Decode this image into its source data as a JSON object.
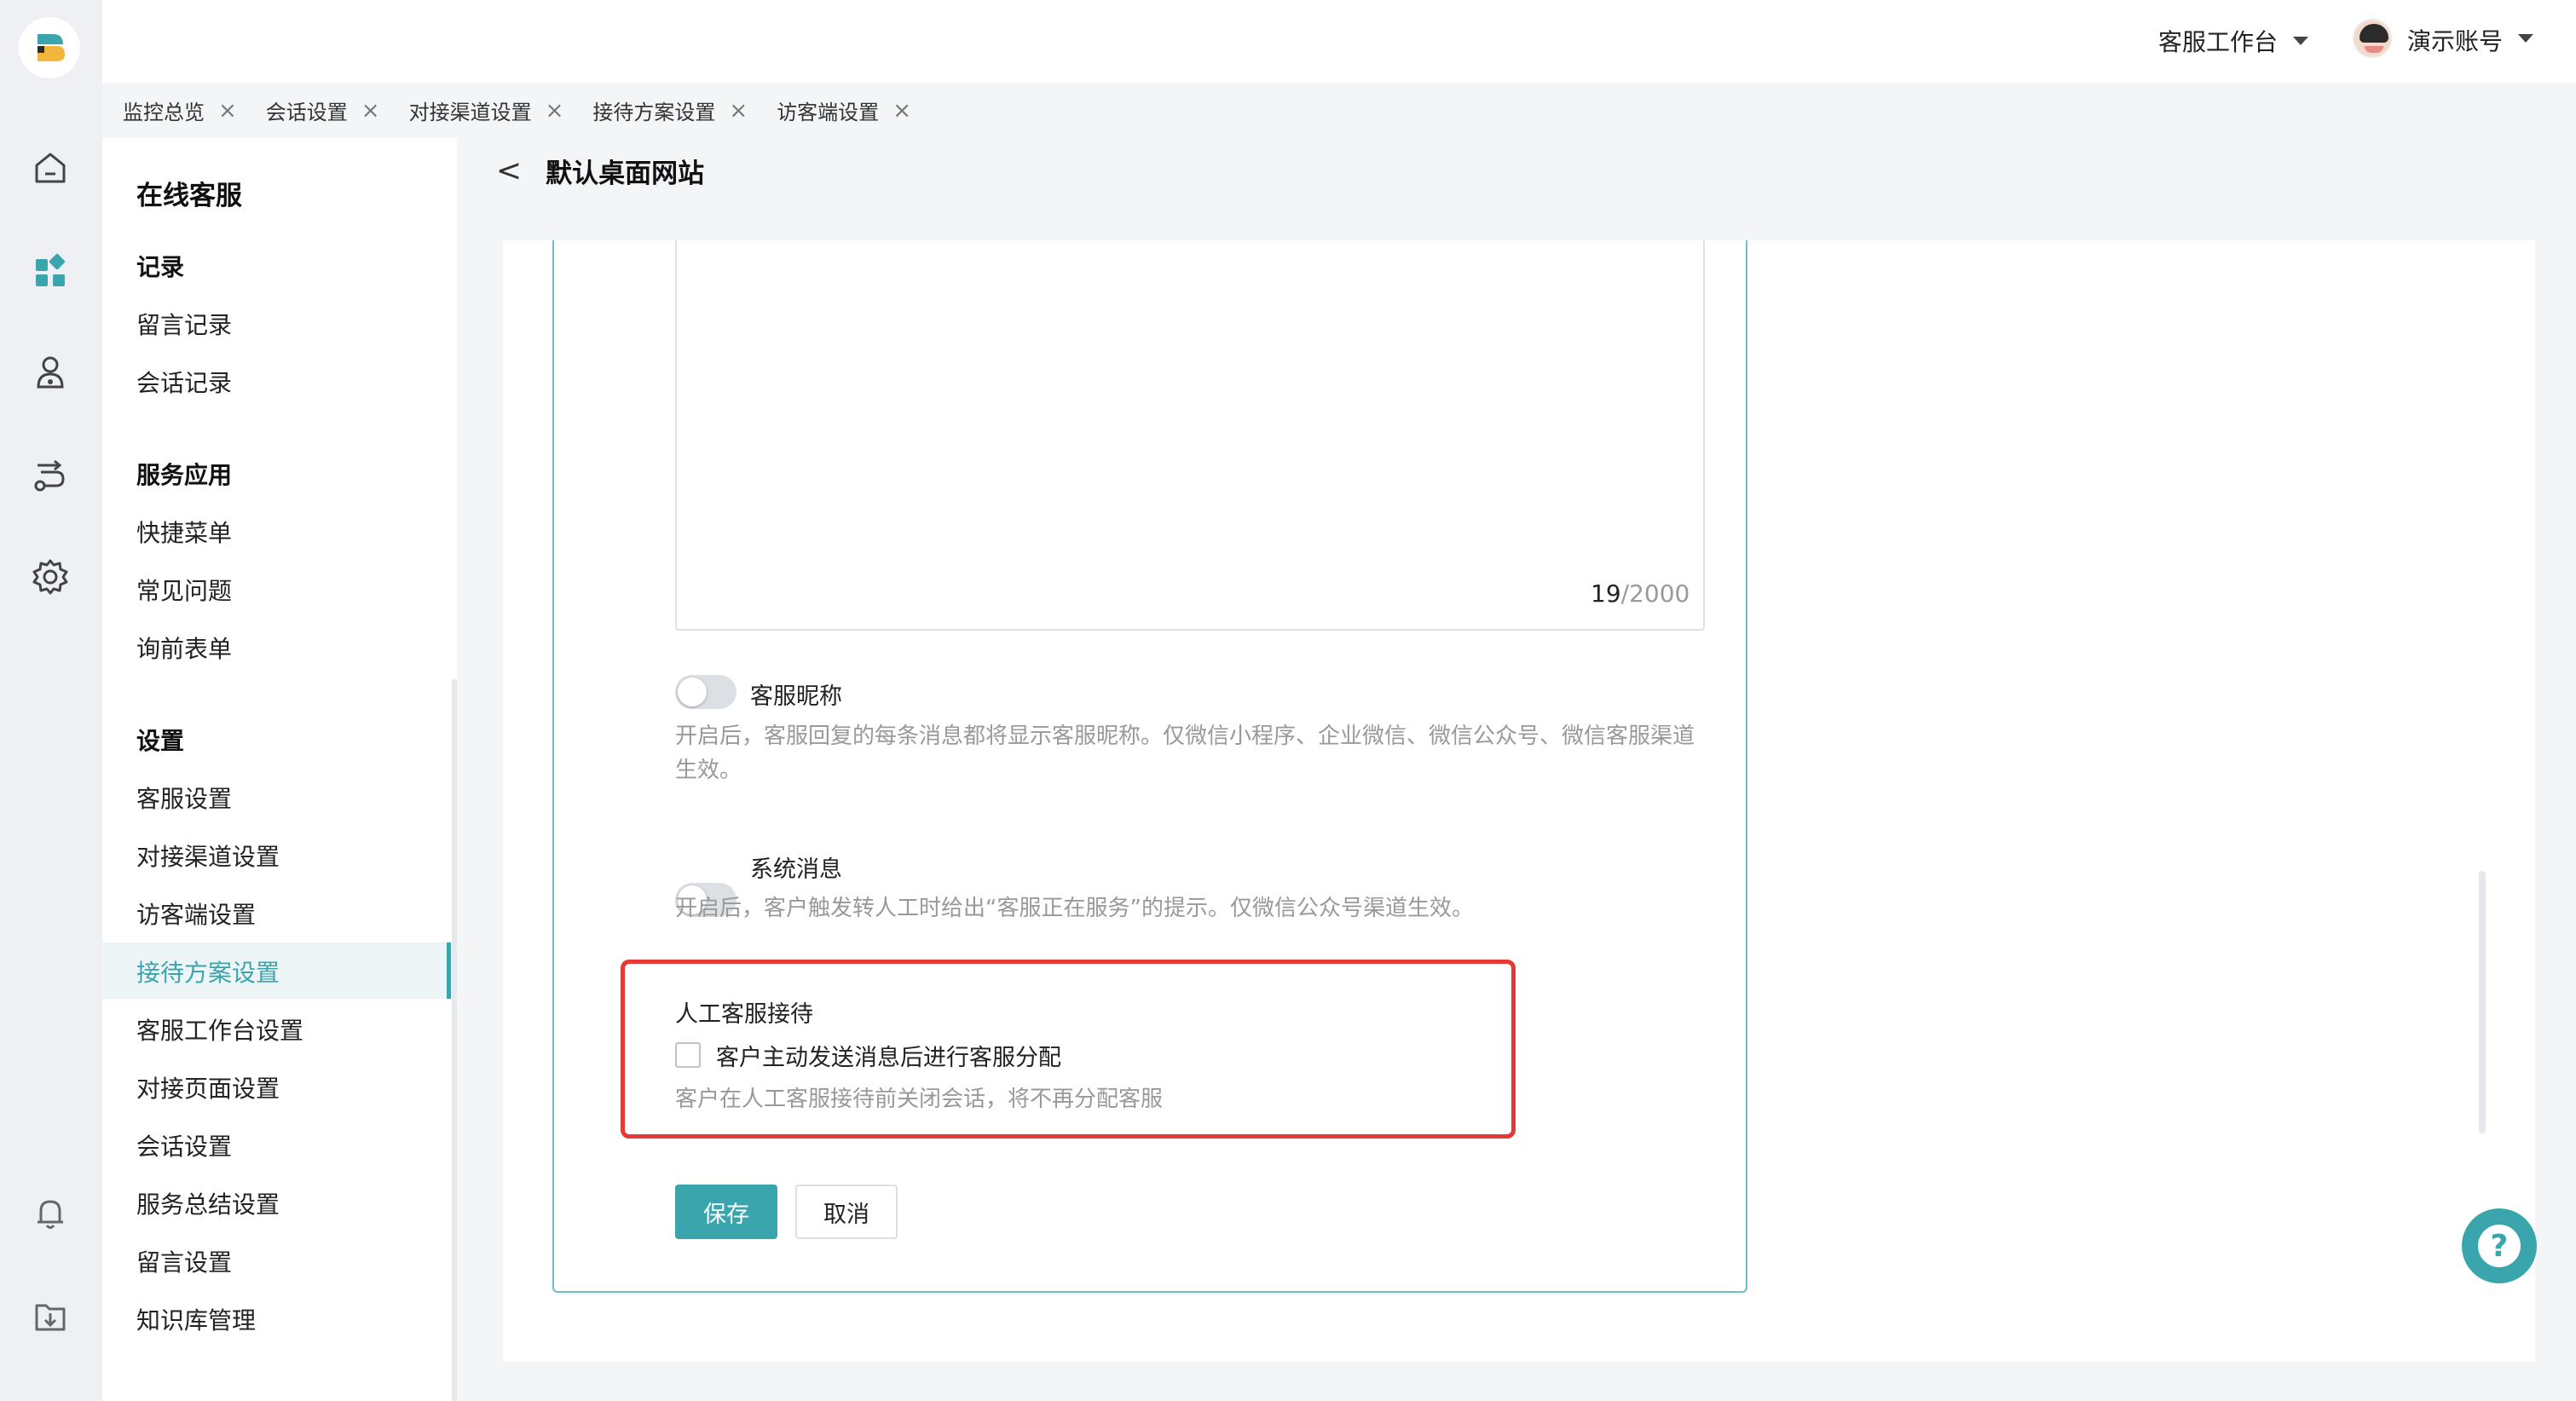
{
  "header": {
    "workspace_menu": "客服工作台",
    "account_menu": "演示账号"
  },
  "tabs": [
    {
      "label": "监控总览"
    },
    {
      "label": "会话设置"
    },
    {
      "label": "对接渠道设置"
    },
    {
      "label": "接待方案设置"
    },
    {
      "label": "访客端设置"
    }
  ],
  "tab_close_glyph": "×",
  "sidebar": {
    "title": "在线客服",
    "groups": [
      {
        "heading": "记录",
        "items": [
          "留言记录",
          "会话记录"
        ]
      },
      {
        "heading": "服务应用",
        "items": [
          "快捷菜单",
          "常见问题",
          "询前表单"
        ]
      },
      {
        "heading": "设置",
        "items": [
          "客服设置",
          "对接渠道设置",
          "访客端设置",
          "接待方案设置",
          "客服工作台设置",
          "对接页面设置",
          "会话设置",
          "服务总结设置",
          "留言设置",
          "知识库管理"
        ]
      }
    ],
    "active_item": "接待方案设置"
  },
  "page": {
    "back_glyph": "<",
    "title": "默认桌面网站"
  },
  "form": {
    "char_count": "19",
    "char_max": "/2000",
    "agent_nickname": {
      "label": "客服昵称",
      "enabled": false,
      "desc": "开启后，客服回复的每条消息都将显示客服昵称。仅微信小程序、企业微信、微信公众号、微信客服渠道生效。"
    },
    "system_message": {
      "label": "系统消息",
      "enabled": false,
      "desc": "开启后，客户触发转人工时给出“客服正在服务”的提示。仅微信公众号渠道生效。"
    },
    "manual_reception": {
      "heading": "人工客服接待",
      "checkbox_label": "客户主动发送消息后进行客服分配",
      "checked": false,
      "desc": "客户在人工客服接待前关闭会话，将不再分配客服"
    },
    "save_label": "保存",
    "cancel_label": "取消"
  },
  "help_glyph": "?",
  "icons": {
    "rail": [
      "home-icon",
      "apps-icon",
      "user-icon",
      "route-icon",
      "settings-icon",
      "bell-icon",
      "download-icon"
    ]
  },
  "colors": {
    "accent": "#3aa5ad",
    "highlight_border": "#e53935"
  }
}
